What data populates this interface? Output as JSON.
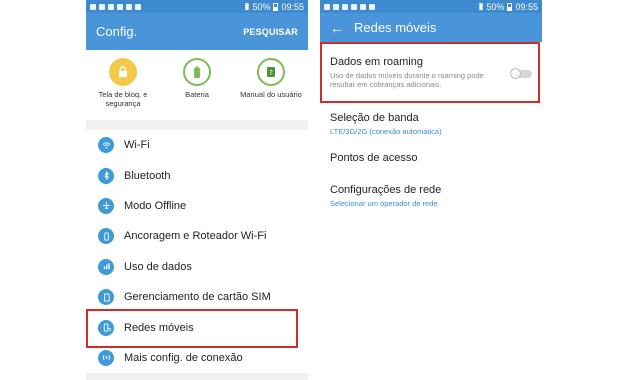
{
  "left": {
    "status": {
      "battery": "50%",
      "time": "09:55"
    },
    "appbar": {
      "title": "Config.",
      "action": "PESQUISAR"
    },
    "tiles": [
      {
        "label": "Tela de bloq. e segurança",
        "icon": "lock-icon"
      },
      {
        "label": "Bateria",
        "icon": "battery-icon"
      },
      {
        "label": "Manual do usuário",
        "icon": "manual-icon"
      }
    ],
    "items": [
      {
        "label": "Wi-Fi",
        "icon": "wifi-icon"
      },
      {
        "label": "Bluetooth",
        "icon": "bluetooth-icon"
      },
      {
        "label": "Modo Offline",
        "icon": "airplane-icon"
      },
      {
        "label": "Ancoragem e Roteador Wi-Fi",
        "icon": "tethering-icon"
      },
      {
        "label": "Uso de dados",
        "icon": "data-usage-icon"
      },
      {
        "label": "Gerenciamento de cartão SIM",
        "icon": "sim-card-icon"
      },
      {
        "label": "Redes móveis",
        "icon": "mobile-networks-icon"
      },
      {
        "label": "Mais config. de conexão",
        "icon": "more-connection-icon"
      }
    ]
  },
  "right": {
    "status": {
      "battery": "50%",
      "time": "09:55"
    },
    "appbar": {
      "title": "Redes móveis"
    },
    "roaming": {
      "title": "Dados em roaming",
      "subtitle": "Uso de dados móveis durante o roaming pode resultar em cobranças adicionais.",
      "enabled": false
    },
    "band": {
      "title": "Seleção de banda",
      "subtitle": "LTE/3G/2G (conexão automática)"
    },
    "access_points": {
      "title": "Pontos de acesso"
    },
    "network": {
      "title": "Configurações de rede",
      "subtitle": "Selecionar um operador de rede"
    }
  },
  "colors": {
    "statusbar": "#3e8acf",
    "appbar": "#4a95d9",
    "highlight": "#d12b2b",
    "tile_ring": "#7dbb54",
    "item_icon": "#3e9ad8"
  }
}
